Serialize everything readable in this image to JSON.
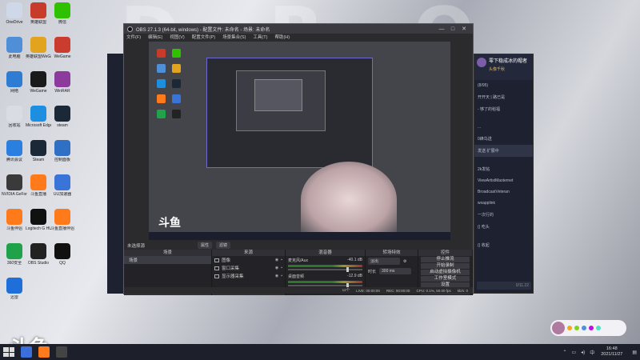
{
  "obs": {
    "title": "OBS 27.1.3 (64-bit, windows) - 配置文件: 未命名 - 场景: 未命名",
    "menu": [
      "文件(F)",
      "编辑(E)",
      "视图(V)",
      "配置文件(P)",
      "场景集合(S)",
      "工具(T)",
      "帮助(H)"
    ],
    "window_controls": [
      "—",
      "□",
      "✕"
    ],
    "no_source_label": "未选择源",
    "properties_btn": "属性",
    "filters_btn": "滤镜",
    "panels": {
      "scenes": "场景",
      "sources": "来源",
      "mixer": "混音器",
      "transitions": "转场特效",
      "controls": "控件"
    },
    "scenes": [
      "场景"
    ],
    "sources": [
      {
        "name": "图像",
        "icon": "image-icon"
      },
      {
        "name": "窗口采集",
        "icon": "window-icon"
      },
      {
        "name": "显示器采集",
        "icon": "monitor-icon"
      }
    ],
    "mixer": [
      {
        "name": "麦克风/Aux",
        "db": "-40.1 dB"
      },
      {
        "name": "桌面音频",
        "db": "-12.9 dB"
      }
    ],
    "transition": {
      "type": "淡出",
      "duration_label": "时长",
      "duration": "300 ms"
    },
    "controls": [
      "停止推流",
      "开始录制",
      "启动虚拟摄像机",
      "工作室模式",
      "设置",
      "退出"
    ],
    "dock_footer_icons": [
      "+",
      "—",
      "⌃",
      "⌄"
    ],
    "status": {
      "frames": "12个",
      "live": "LIVE: 00:00:00",
      "rec": "REC: 00:00:00",
      "cpu": "CPU: 0.1%, 60.00 fps",
      "bitrate": "kb/s: 0"
    }
  },
  "desktop": {
    "wallpaper_letters": "D R O K E N",
    "logo": "斗鱼",
    "icons": [
      {
        "label": "OneDrive",
        "color": "#cfd8e8"
      },
      {
        "label": "英雄联盟",
        "color": "#c73b2a"
      },
      {
        "label": "微信",
        "color": "#2dc100"
      },
      {
        "label": "此电脑",
        "color": "#4f8fd8"
      },
      {
        "label": "英雄联盟WeGame",
        "color": "#e2a31f"
      },
      {
        "label": "WeGame",
        "color": "#c93c2e"
      },
      {
        "label": "网络",
        "color": "#2f7cd3"
      },
      {
        "label": "WeGame",
        "color": "#1a1a1a"
      },
      {
        "label": "WinRAR",
        "color": "#8c3b9c"
      },
      {
        "label": "回收站",
        "color": "#d9dce2"
      },
      {
        "label": "Microsoft Edge",
        "color": "#1d8fe0"
      },
      {
        "label": "steam",
        "color": "#1b2838"
      },
      {
        "label": "腾讯会议",
        "color": "#2a7fe0"
      },
      {
        "label": "Steam",
        "color": "#1b2838"
      },
      {
        "label": "控制面板",
        "color": "#2f6fc4"
      },
      {
        "label": "NVIDIA GeForce",
        "color": "#3a3a3a"
      },
      {
        "label": "斗鱼直播",
        "color": "#ff7a1a"
      },
      {
        "label": "UU加速器",
        "color": "#3b74d9"
      },
      {
        "label": "斗鱼伴侣",
        "color": "#ff7a1a"
      },
      {
        "label": "Logitech G HUB",
        "color": "#111"
      },
      {
        "label": "斗鱼直播伴侣",
        "color": "#ff7a1a"
      },
      {
        "label": "360安全",
        "color": "#1fa24a"
      },
      {
        "label": "OBS Studio",
        "color": "#222"
      },
      {
        "label": "QQ",
        "color": "#111"
      },
      {
        "label": "迅雷",
        "color": "#1e6fd9"
      }
    ]
  },
  "chat": {
    "title": "零下稳成冰的帽者",
    "subtitle": "头像千秋",
    "lines": [
      "(8/95)",
      "开开天 | 路已是",
      "- 够了的稻福",
      "",
      "...",
      "0蜂鸟送",
      "发送·扩展中",
      "",
      "2k发帖",
      "ViewArtistMasternet",
      "BroadcastVeteran",
      "wxapplink",
      "一次行的",
      "() 吃头",
      "",
      "()  收起"
    ],
    "input_placeholder": "0/11.22"
  },
  "taskbar": {
    "time": "16:48",
    "date": "2021/11/27",
    "ime": "中",
    "apps": [
      "#3b6fd9",
      "#ff7a1a",
      "#444"
    ]
  }
}
